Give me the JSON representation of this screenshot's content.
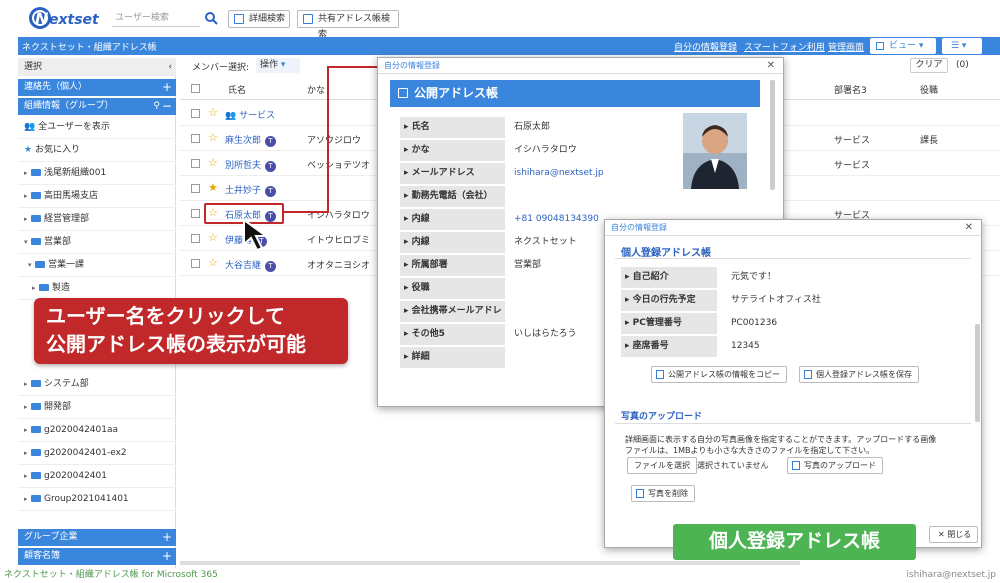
{
  "app": {
    "logo": "Nextset",
    "search_placeholder": "ユーザー検索",
    "detail_search": "詳細検索",
    "shared_search": "共有アドレス帳検索"
  },
  "bar": {
    "title": "ネクストセット・組織アドレス帳",
    "links": [
      "自分の情報登録",
      "スマートフォン利用",
      "管理画面"
    ],
    "view": "ビュー"
  },
  "sidebar": {
    "select": "選択",
    "contacts": "連絡先（個人）",
    "org": "組織情報（グループ）",
    "all_users": "全ユーザーを表示",
    "favorites": "お気に入り",
    "items": [
      "浅尾新組織001",
      "高田馬場支店",
      "経営管理部",
      "営業部",
      "営業一課",
      "製造",
      "システム部",
      "開発部",
      "g2020042401aa",
      "g2020042401-ex2",
      "g2020042401",
      "Group2021041401"
    ],
    "group": "グループ企業",
    "customers": "顧客名簿"
  },
  "toolbar": {
    "member_select": "メンバー選択:",
    "ops": "操作",
    "clear": "クリア",
    "count": "(0)"
  },
  "table": {
    "headers": [
      "氏名",
      "かな",
      "部署名3",
      "役職"
    ],
    "rows": [
      {
        "name": "サービス",
        "kana": "",
        "dept": "",
        "pos": ""
      },
      {
        "name": "麻生次郎",
        "kana": "アソウジロウ",
        "dept": "サービス",
        "pos": "課長"
      },
      {
        "name": "別所哲夫",
        "kana": "ベッショテツオ",
        "dept": "サービス",
        "pos": ""
      },
      {
        "name": "土井妙子",
        "kana": "",
        "dept": "",
        "pos": ""
      },
      {
        "name": "石原太郎",
        "kana": "イシハラタロウ",
        "dept": "サービス",
        "pos": ""
      },
      {
        "name": "伊藤博",
        "kana": "イトウヒロブミ",
        "dept": "",
        "pos": ""
      },
      {
        "name": "大谷吉継",
        "kana": "オオタニヨシオ",
        "dept": "",
        "pos": ""
      }
    ]
  },
  "callout": {
    "line1": "ユーザー名をクリックして",
    "line2": "公開アドレス帳の表示が可能"
  },
  "dialog1": {
    "header": "自分の情報登録",
    "title": "公開アドレス帳",
    "fields": [
      {
        "label": "氏名",
        "value": "石原太郎"
      },
      {
        "label": "かな",
        "value": "イシハラタロウ"
      },
      {
        "label": "メールアドレス",
        "value": "ishihara@nextset.jp"
      },
      {
        "label": "勤務先電話（会社）",
        "value": ""
      },
      {
        "label": "内線",
        "value": "+81 09048134390"
      },
      {
        "label": "内線",
        "value": "ネクストセット"
      },
      {
        "label": "所属部署",
        "value": "営業部"
      },
      {
        "label": "役職",
        "value": ""
      },
      {
        "label": "会社携帯メールアドレス",
        "value": ""
      },
      {
        "label": "その他5",
        "value": "いしはらたろう"
      },
      {
        "label": "詳細",
        "value": ""
      }
    ]
  },
  "dialog2": {
    "header": "自分の情報登録",
    "title": "個人登録アドレス帳",
    "fields": [
      {
        "label": "自己紹介",
        "value": "元気です！"
      },
      {
        "label": "今日の行先予定",
        "value": "サテライトオフィス社"
      },
      {
        "label": "PC管理番号",
        "value": "PC001236"
      },
      {
        "label": "座席番号",
        "value": "12345"
      }
    ],
    "copy_btn": "公開アドレス帳の情報をコピー",
    "save_btn": "個人登録アドレス帳を保存",
    "photo_title": "写真のアップロード",
    "photo_desc1": "詳細画面に表示する自分の写真画像を指定することができます。アップロードする画像",
    "photo_desc2": "ファイルは、1MBよりも小さな大きさのファイルを指定して下さい。",
    "file_btn": "ファイルを選択",
    "file_none": "選択されていません",
    "upload_btn": "写真のアップロード",
    "delete_btn": "写真を削除",
    "close": "閉じる"
  },
  "green_label": "個人登録アドレス帳",
  "footer": {
    "left": "ネクストセット・組織アドレス帳 for Microsoft 365",
    "right": "ishihara@nextset.jp"
  },
  "colors": {
    "accent": "#3b86dd",
    "callout": "#c0282a",
    "green": "#4db453"
  }
}
